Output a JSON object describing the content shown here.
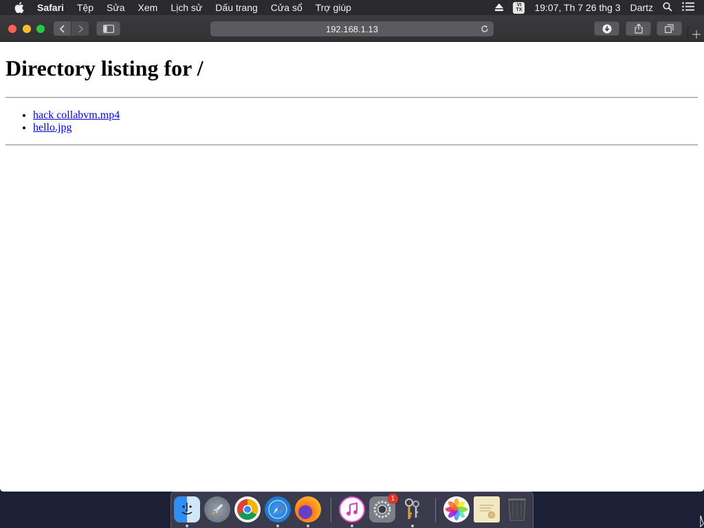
{
  "menubar": {
    "app_name": "Safari",
    "items": [
      "Tệp",
      "Sửa",
      "Xem",
      "Lịch sử",
      "Dấu trang",
      "Cửa sổ",
      "Trợ giúp"
    ],
    "input_method_top": "VI",
    "input_method_bottom": "TX",
    "clock": "19:07, Th 7 26 thg 3",
    "user": "Dartz"
  },
  "browser": {
    "address": "192.168.1.13"
  },
  "page": {
    "heading": "Directory listing for /",
    "files": [
      "hack collabvm.mp4",
      "hello.jpg"
    ]
  },
  "dock": {
    "apps": [
      "Finder",
      "Launchpad",
      "Google Chrome",
      "Safari",
      "Firefox",
      "iTunes",
      "System Preferences",
      "Keychain Access",
      "Photos",
      "Certificate Assistant",
      "Trash"
    ],
    "system_prefs_badge": "1"
  },
  "colors": {
    "link": "#0000ee",
    "menubar": "#2a2a2c",
    "toolbar": "#3b3b3d",
    "badge": "#e0352b"
  }
}
